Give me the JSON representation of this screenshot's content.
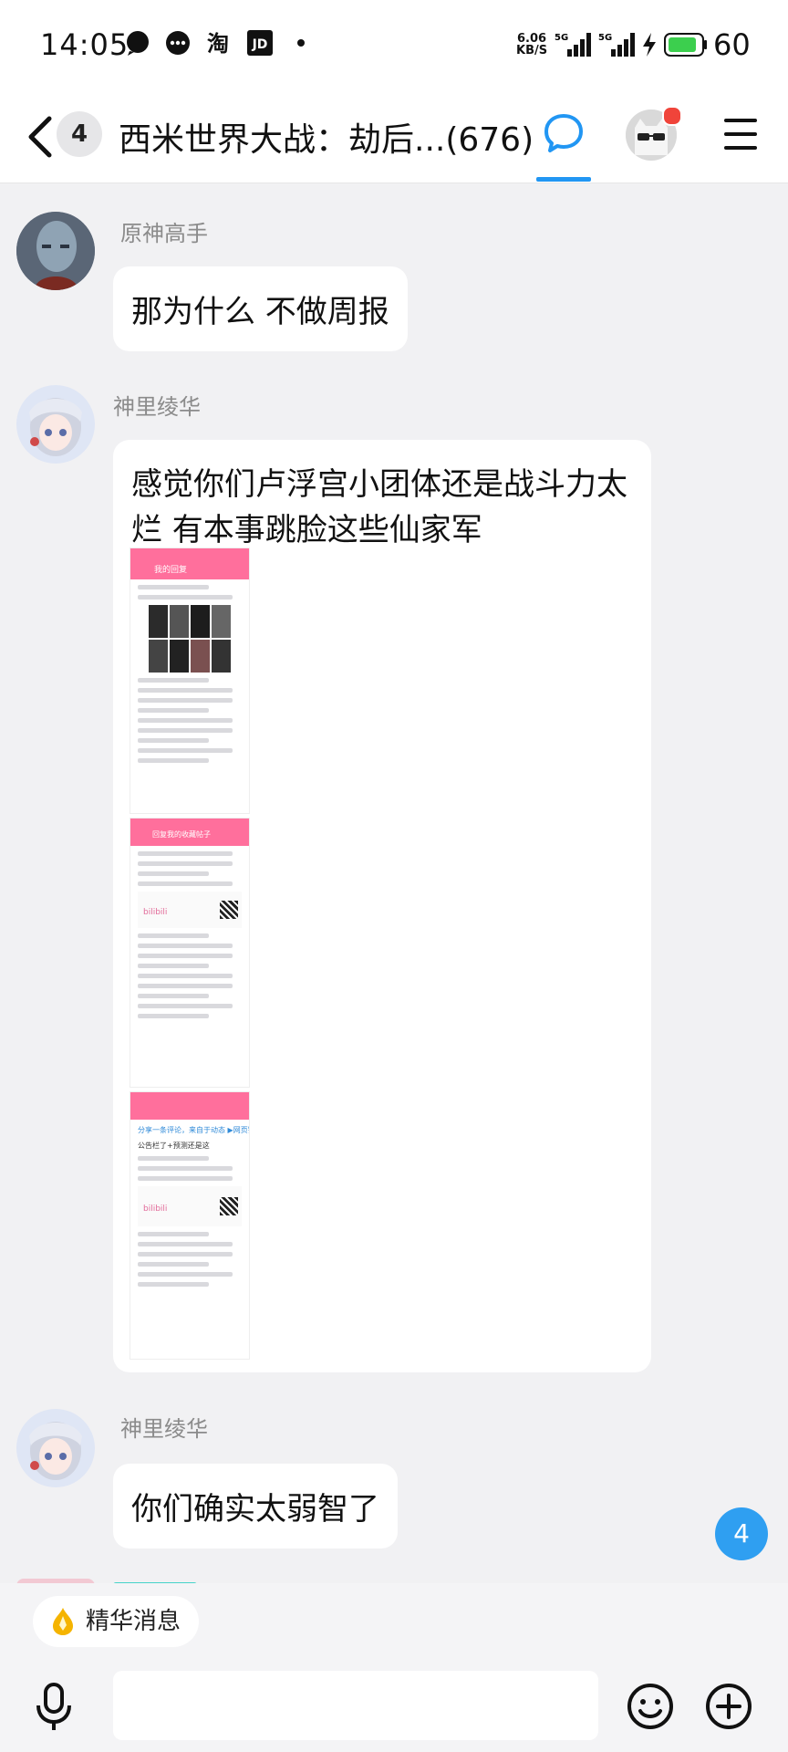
{
  "status_bar": {
    "time": "14:05",
    "net_speed_value": "6.06",
    "net_speed_unit": "KB/S",
    "sig1": "5G",
    "sig2": "5G",
    "battery": "60",
    "icons": [
      "chat-bubble-icon",
      "message-icon",
      "taobao-icon",
      "jd-icon",
      "dot-icon",
      "charging-icon",
      "battery-icon"
    ]
  },
  "header": {
    "back_count": "4",
    "title": "西米世界大战：劫后...(676)",
    "accent": "#2196f3"
  },
  "messages": [
    {
      "sender": "原神高手",
      "text": "那为什么 不做周报"
    },
    {
      "sender": "神里绫华",
      "text": "感觉你们卢浮宫小团体还是战斗力太烂 有本事跳脸这些仙家军",
      "has_image": true
    },
    {
      "sender": "神里绫华",
      "text": "你们确实太弱智了"
    }
  ],
  "shot": {
    "p1_title": "我的回复",
    "p2_title": "回复我的收藏帖子",
    "p3_hint": "分享一条评论，来自于动态 ▶网页链接",
    "p3_sub": "公告栏了+预测还是这",
    "bili": "bilibili"
  },
  "bottom": {
    "essence_label": "精华消息",
    "unread_count": "4"
  }
}
